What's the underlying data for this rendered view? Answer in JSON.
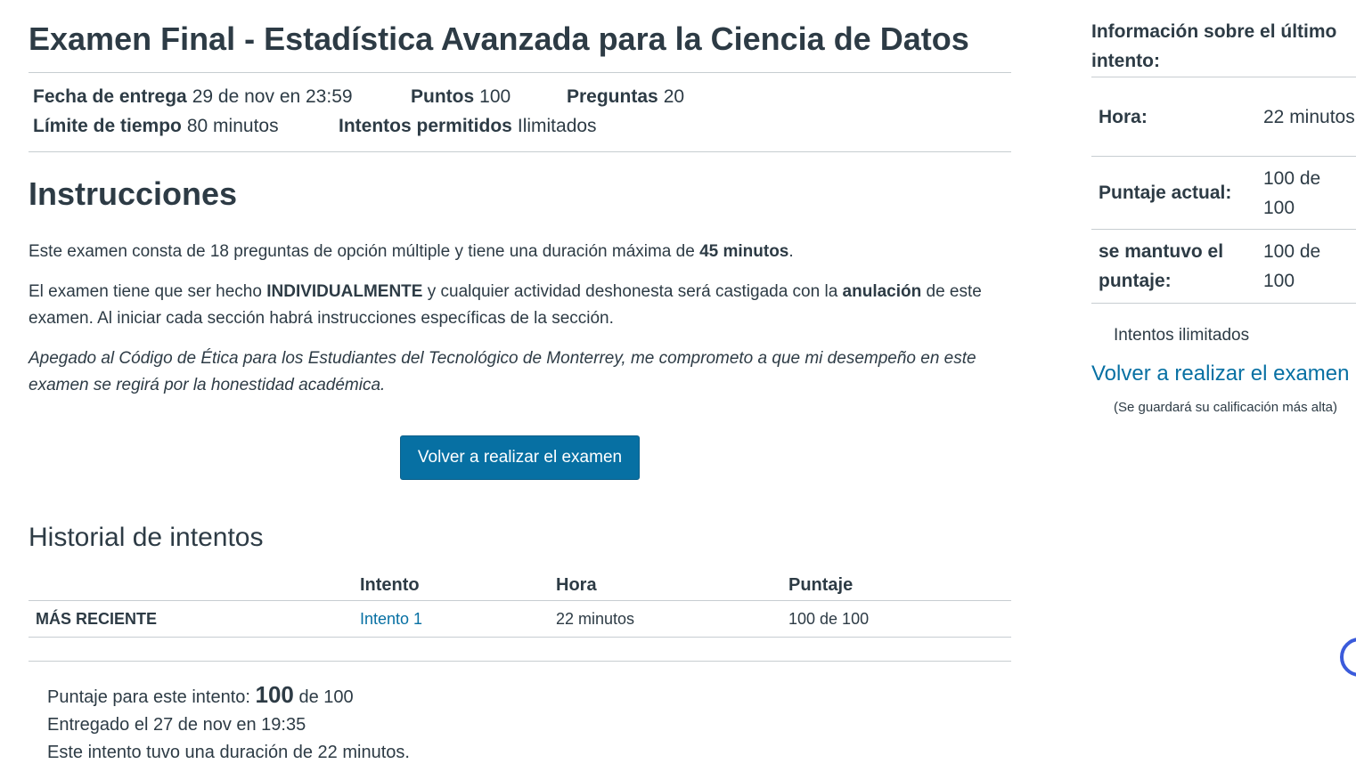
{
  "quiz": {
    "title": "Examen Final - Estadística Avanzada para la Ciencia de Datos",
    "due_label": "Fecha de entrega",
    "due_value": "29 de nov en 23:59",
    "points_label": "Puntos",
    "points_value": "100",
    "questions_label": "Preguntas",
    "questions_value": "20",
    "time_limit_label": "Límite de tiempo",
    "time_limit_value": "80 minutos",
    "attempts_label": "Intentos permitidos",
    "attempts_value": "Ilimitados"
  },
  "instructions": {
    "heading": "Instrucciones",
    "p1_a": "Este examen consta de 18 preguntas de opción múltiple y tiene una duración máxima de ",
    "p1_b": "45 minutos",
    "p1_c": ".",
    "p2_a": "El examen tiene que ser hecho ",
    "p2_b": "INDIVIDUALMENTE",
    "p2_c": " y cualquier actividad deshonesta será castigada con la ",
    "p2_d": "anulación",
    "p2_e": " de este examen. Al iniciar cada sección habrá instrucciones específicas de la sección.",
    "p3": "Apegado al Código de Ética para los Estudiantes del Tecnológico de Monterrey, me comprometo a que mi desempeño en este examen se regirá por la honestidad académica."
  },
  "retake_button": "Volver a realizar el examen",
  "history": {
    "heading": "Historial de intentos",
    "columns": [
      "",
      "Intento",
      "Hora",
      "Puntaje"
    ],
    "rows": [
      {
        "label": "MÁS RECIENTE",
        "attempt": "Intento 1",
        "time": "22 minutos",
        "score": "100 de 100"
      }
    ]
  },
  "summary": {
    "score_prefix": "Puntaje para este intento: ",
    "score_value": "100",
    "score_suffix": " de 100",
    "submitted": "Entregado el 27 de nov en 19:35",
    "duration": "Este intento tuvo una duración de 22 minutos."
  },
  "sidebar": {
    "title": "Información sobre el último intento:",
    "rows": [
      {
        "label": "Hora:",
        "value": "22 minutos"
      },
      {
        "label": "Puntaje actual:",
        "value": "100 de 100"
      },
      {
        "label": "se mantuvo el puntaje:",
        "value": "100 de 100"
      }
    ],
    "attempts_text": "Intentos ilimitados",
    "retake_link": "Volver a realizar el examen",
    "note": "(Se guardará su calificación más alta)"
  },
  "colors": {
    "link": "#0770a3",
    "button": "#0770a3",
    "text": "#2d3b45",
    "rule": "#c7cdd1"
  }
}
